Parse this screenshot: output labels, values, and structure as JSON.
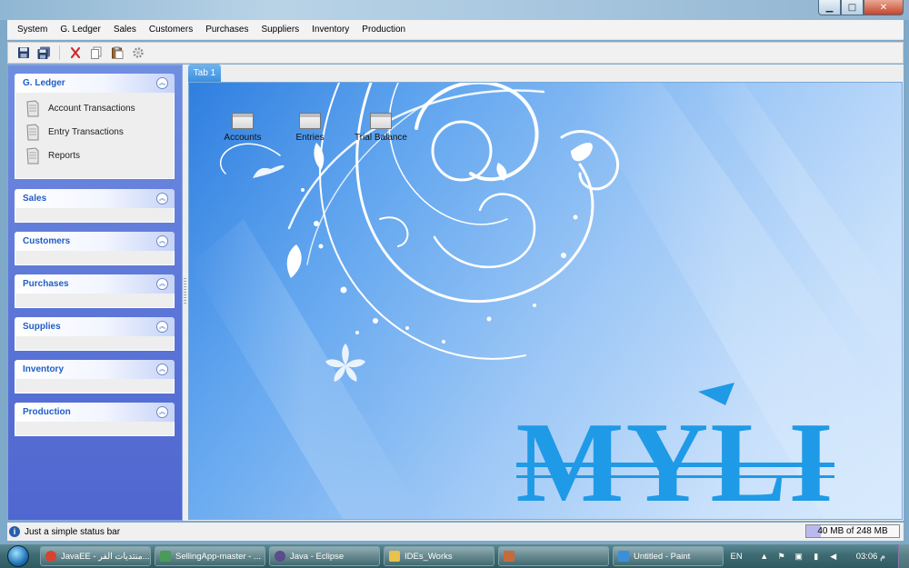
{
  "window": {
    "minimize_glyph": "▁",
    "maximize_glyph": "□",
    "close_glyph": "✕"
  },
  "menubar": {
    "items": [
      "System",
      "G. Ledger",
      "Sales",
      "Customers",
      "Purchases",
      "Suppliers",
      "Inventory",
      "Production"
    ]
  },
  "toolbar": {
    "icons": [
      "save-icon",
      "save-all-icon",
      "cut-icon",
      "copy-icon",
      "paste-icon",
      "settings-icon"
    ]
  },
  "sidebar": {
    "collapse_glyph": "︽",
    "groups": [
      {
        "title": "G. Ledger",
        "tasks": [
          "Account Transactions",
          "Entry Transactions",
          "Reports"
        ]
      },
      {
        "title": "Sales"
      },
      {
        "title": "Customers"
      },
      {
        "title": "Purchases"
      },
      {
        "title": "Supplies"
      },
      {
        "title": "Inventory"
      },
      {
        "title": "Production"
      }
    ]
  },
  "tabs": [
    "Tab 1"
  ],
  "desktop": {
    "icons": [
      "Accounts",
      "Entries",
      "Trial Balance"
    ],
    "logo_text": "MYLI",
    "logo_color": "#1f9ae6"
  },
  "statusbar": {
    "text": "Just a simple status bar",
    "memory_text": "40 MB of 248 MB",
    "memory_used_fraction": 0.16
  },
  "taskbar": {
    "buttons": [
      {
        "label": "JavaEE - منتديات الفر...",
        "icon": "chrome-icon",
        "color": "#d8432f"
      },
      {
        "label": "SellingApp-master - ...",
        "icon": "app-icon",
        "color": "#4a9a5a"
      },
      {
        "label": "Java - Eclipse",
        "icon": "eclipse-icon",
        "color": "#5b4c8c"
      },
      {
        "label": "IDEs_Works",
        "icon": "folder-icon",
        "color": "#e8c24a"
      },
      {
        "label": "",
        "icon": "java-icon",
        "color": "#c76a3a"
      },
      {
        "label": "Untitled - Paint",
        "icon": "paint-icon",
        "color": "#3a8fd8"
      }
    ],
    "language": "EN",
    "clock": "03:06 م",
    "tray_icons": [
      "show-hidden-icon",
      "flag-icon",
      "safely-remove-icon",
      "network-icon",
      "volume-icon"
    ]
  }
}
